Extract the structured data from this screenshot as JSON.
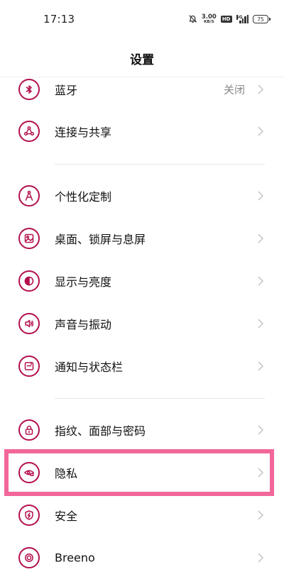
{
  "status_bar": {
    "time": "17:13",
    "net_speed": "3.00",
    "net_speed_unit": "KB/S",
    "hd_badge": "HD",
    "signal_label": "5G",
    "battery_level": "75"
  },
  "header": {
    "title": "设置"
  },
  "settings": {
    "items": [
      {
        "id": "bluetooth",
        "label": "蓝牙",
        "value": "关闭",
        "icon": "bluetooth-icon"
      },
      {
        "id": "connection",
        "label": "连接与共享",
        "icon": "share-network-icon"
      },
      {
        "id": "personalization",
        "label": "个性化定制",
        "icon": "compass-icon"
      },
      {
        "id": "desktop",
        "label": "桌面、锁屏与息屏",
        "icon": "wallpaper-icon"
      },
      {
        "id": "display",
        "label": "显示与亮度",
        "icon": "contrast-icon"
      },
      {
        "id": "sound",
        "label": "声音与振动",
        "icon": "speaker-icon"
      },
      {
        "id": "notification",
        "label": "通知与状态栏",
        "icon": "notification-panel-icon"
      },
      {
        "id": "fingerprint",
        "label": "指纹、面部与密码",
        "icon": "lock-icon"
      },
      {
        "id": "privacy",
        "label": "隐私",
        "icon": "privacy-eye-icon"
      },
      {
        "id": "security",
        "label": "安全",
        "icon": "shield-icon"
      },
      {
        "id": "breeno",
        "label": "Breeno",
        "icon": "breeno-icon"
      }
    ]
  },
  "colors": {
    "accent": "#b3104e",
    "highlight": "#f2679a"
  }
}
